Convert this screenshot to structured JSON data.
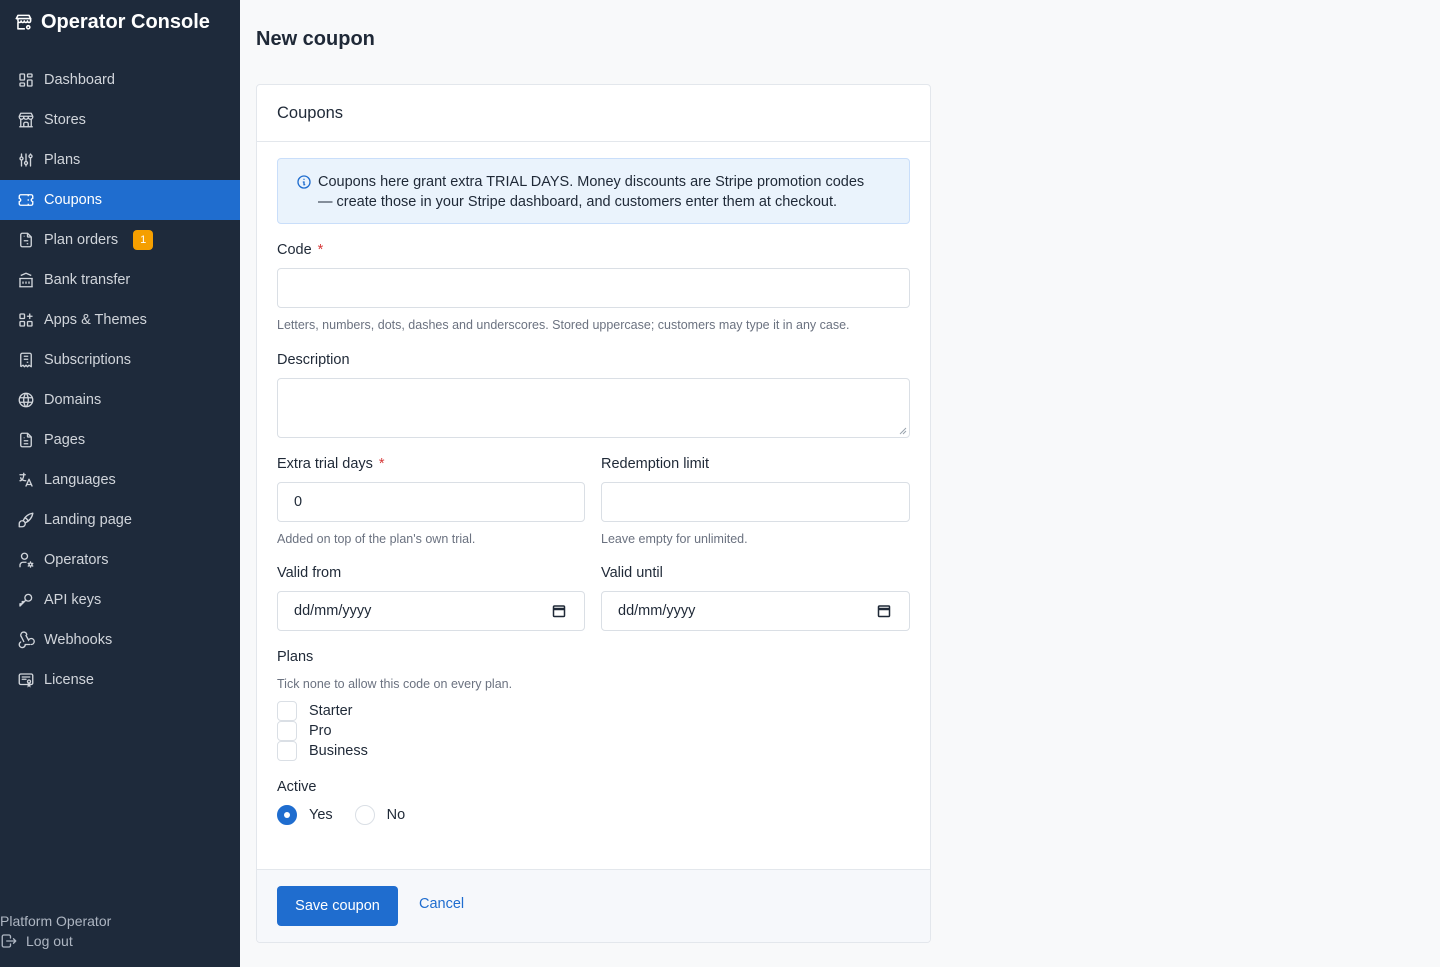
{
  "app": {
    "title": "Operator Console",
    "logo_icon": "store-cog-icon"
  },
  "sidebar": {
    "items": [
      {
        "label": "Dashboard",
        "icon": "dashboard-icon",
        "active": false
      },
      {
        "label": "Stores",
        "icon": "building-store-icon",
        "active": false
      },
      {
        "label": "Plans",
        "icon": "adjustments-icon",
        "active": false
      },
      {
        "label": "Coupons",
        "icon": "ticket-icon",
        "active": true
      },
      {
        "label": "Plan orders",
        "icon": "file-invoice-icon",
        "active": false,
        "badge": "1"
      },
      {
        "label": "Bank transfer",
        "icon": "building-bank-icon",
        "active": false
      },
      {
        "label": "Apps & Themes",
        "icon": "apps-icon",
        "active": false
      },
      {
        "label": "Subscriptions",
        "icon": "receipt-icon",
        "active": false
      },
      {
        "label": "Domains",
        "icon": "world-icon",
        "active": false
      },
      {
        "label": "Pages",
        "icon": "file-text-icon",
        "active": false
      },
      {
        "label": "Languages",
        "icon": "language-icon",
        "active": false
      },
      {
        "label": "Landing page",
        "icon": "brush-icon",
        "active": false
      },
      {
        "label": "Operators",
        "icon": "user-cog-icon",
        "active": false
      },
      {
        "label": "API keys",
        "icon": "key-icon",
        "active": false
      },
      {
        "label": "Webhooks",
        "icon": "webhook-icon",
        "active": false
      },
      {
        "label": "License",
        "icon": "certificate-icon",
        "active": false
      }
    ],
    "footer": {
      "operator": "Platform Operator",
      "logout": "Log out"
    }
  },
  "page": {
    "title": "New coupon"
  },
  "card": {
    "title": "Coupons",
    "alert": {
      "line1": "Coupons here grant extra TRIAL DAYS. Money discounts are Stripe promotion codes",
      "line2": "— create those in your Stripe dashboard, and customers enter them at checkout."
    },
    "code": {
      "label": "Code",
      "required": "*",
      "value": "",
      "hint": "Letters, numbers, dots, dashes and underscores. Stored uppercase; customers may type it in any case."
    },
    "description": {
      "label": "Description",
      "value": ""
    },
    "extra_trial_days": {
      "label": "Extra trial days",
      "required": "*",
      "value": "0",
      "hint": "Added on top of the plan's own trial."
    },
    "redemption_limit": {
      "label": "Redemption limit",
      "value": "",
      "hint": "Leave empty for unlimited."
    },
    "valid_from": {
      "label": "Valid from",
      "value": "dd/mm/yyyy"
    },
    "valid_until": {
      "label": "Valid until",
      "value": "dd/mm/yyyy"
    },
    "plans": {
      "label": "Plans",
      "hint": "Tick none to allow this code on every plan.",
      "options": [
        {
          "label": "Starter",
          "checked": false
        },
        {
          "label": "Pro",
          "checked": false
        },
        {
          "label": "Business",
          "checked": false
        }
      ]
    },
    "active": {
      "label": "Active",
      "options": [
        {
          "label": "Yes",
          "checked": true
        },
        {
          "label": "No",
          "checked": false
        }
      ]
    },
    "actions": {
      "save": "Save coupon",
      "cancel": "Cancel"
    }
  },
  "colors": {
    "sidebar_bg": "#1e2a3b",
    "primary": "#1f6dcf",
    "badge": "#f59f00",
    "required": "#d63939",
    "alert_bg": "#eaf3fc"
  }
}
